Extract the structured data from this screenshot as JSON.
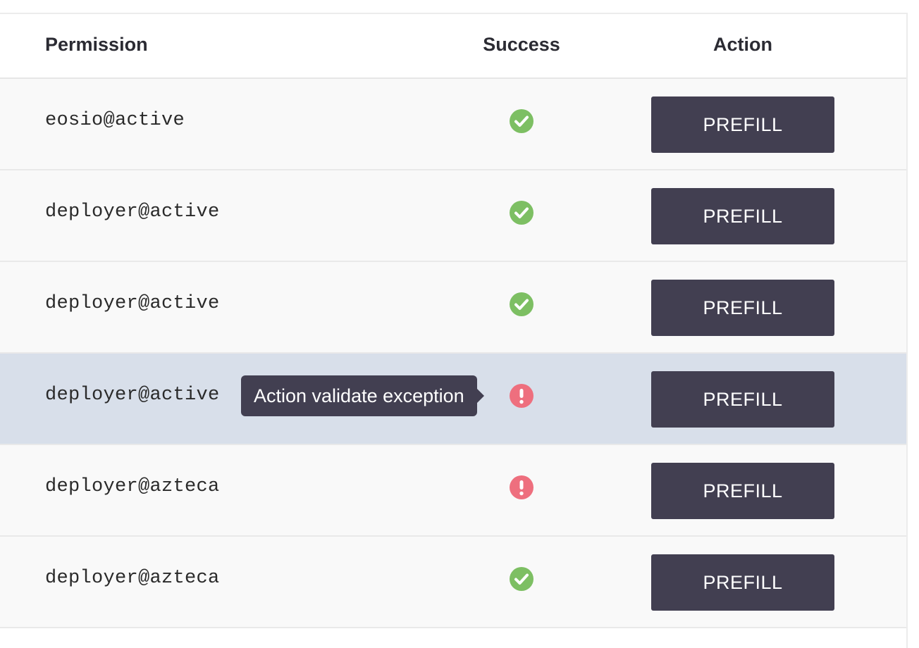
{
  "table": {
    "headers": {
      "permission": "Permission",
      "success": "Success",
      "action": "Action"
    },
    "rows": [
      {
        "permission": "eosio@active",
        "status": "success",
        "button": "PREFILL"
      },
      {
        "permission": "deployer@active",
        "status": "success",
        "button": "PREFILL"
      },
      {
        "permission": "deployer@active",
        "status": "success",
        "button": "PREFILL"
      },
      {
        "permission": "deployer@active",
        "status": "error",
        "button": "PREFILL",
        "tooltip": "Action validate exception"
      },
      {
        "permission": "deployer@azteca",
        "status": "error",
        "button": "PREFILL"
      },
      {
        "permission": "deployer@azteca",
        "status": "success",
        "button": "PREFILL"
      }
    ]
  },
  "icons": {
    "success": "check-circle-icon",
    "error": "exclamation-circle-icon"
  },
  "colors": {
    "success": "#7dbf63",
    "error": "#ee6f7e",
    "button": "#423f51",
    "highlight_row": "#d8dfea"
  }
}
